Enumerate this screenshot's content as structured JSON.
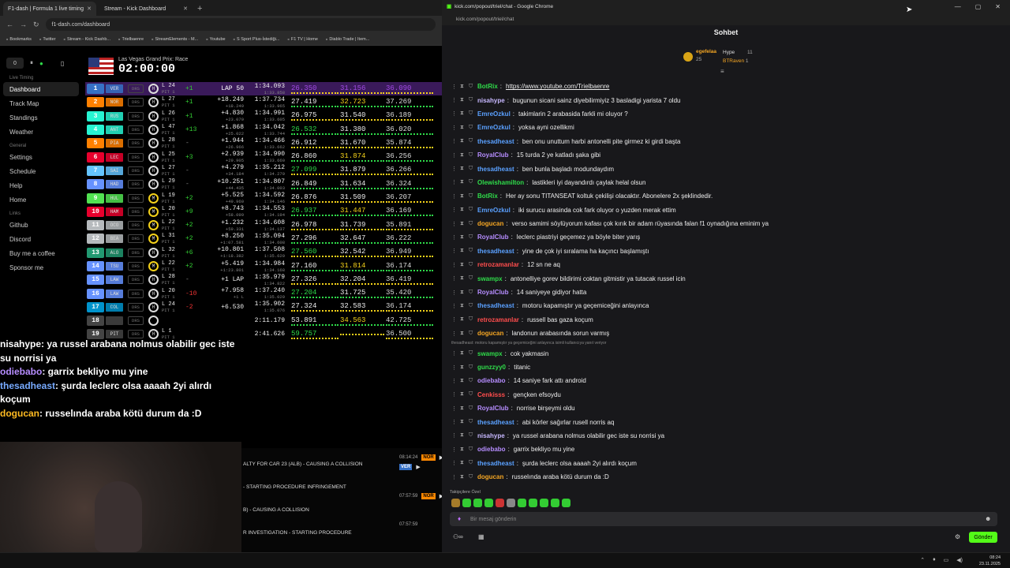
{
  "colors": {
    "purple": "#a24be4",
    "green": "#2fdc4a",
    "yellow": "#f5d21a",
    "kick": "#53fc18",
    "lead_row": "#3a1a5a"
  },
  "browser_left": {
    "tabs": [
      {
        "label": "F1-dash | Formula 1 live timing"
      },
      {
        "label": "Stream - Kick Dashboard"
      }
    ],
    "url": "f1-dash.com/dashboard",
    "bookmarks": [
      "Bookmarks",
      "Twitter",
      "Stream - Kick Dashb...",
      "Trielbaenre",
      "StreamElements - M...",
      "Youtube",
      "S Sport Plus-İstediği...",
      "F1 TV | Home",
      "Diablo Trade | Item..."
    ]
  },
  "dashboard": {
    "counter": "0",
    "nav_groups": [
      {
        "label": "Live Timing",
        "items": [
          "Dashboard",
          "Track Map",
          "Standings",
          "Weather"
        ]
      },
      {
        "label": "General",
        "items": [
          "Settings",
          "Schedule",
          "Help",
          "Home"
        ]
      },
      {
        "label": "Links",
        "items": [
          "Github",
          "Discord",
          "Buy me a coffee",
          "Sponsor me"
        ]
      }
    ],
    "race_name": "Las Vegas Grand Prix: Race",
    "race_clock": "02:00:00",
    "drivers": [
      {
        "pos": "1",
        "code": "VER",
        "color": "#3671c6",
        "tyre": "H",
        "lap": "L 24",
        "pit": "PIT 1",
        "gain": "+1",
        "gap": "LAP 50",
        "gap2": "",
        "last": "1:34.093",
        "best": "1:33.858",
        "s1": "26.350",
        "s2": "31.156",
        "s3": "36.090"
      },
      {
        "pos": "2",
        "code": "NOR",
        "color": "#ff8000",
        "tyre": "H",
        "lap": "L 27",
        "pit": "PIT 1",
        "gain": "+1",
        "gap": "+18.249",
        "gap2": "+18.249",
        "last": "1:37.734",
        "best": "1:33.965",
        "s1": "27.419",
        "s2": "32.723",
        "s3": "37.269"
      },
      {
        "pos": "3",
        "code": "RUS",
        "color": "#27f4d2",
        "tyre": "H",
        "lap": "L 26",
        "pit": "PIT 1",
        "gain": "+1",
        "gap": "+4.830",
        "gap2": "+23.079",
        "last": "1:34.991",
        "best": "1:33.605",
        "s1": "26.975",
        "s2": "31.540",
        "s3": "36.189"
      },
      {
        "pos": "4",
        "code": "ANT",
        "color": "#27f4d2",
        "tyre": "H",
        "lap": "L 47",
        "pit": "PIT 1",
        "gain": "+13",
        "gap": "+1.868",
        "gap2": "+25.022",
        "last": "1:34.042",
        "best": "1:33.744",
        "s1": "26.532",
        "s2": "31.380",
        "s3": "36.020"
      },
      {
        "pos": "5",
        "code": "PIA",
        "color": "#ff8000",
        "tyre": "H",
        "lap": "L 28",
        "pit": "PIT 1",
        "gain": "-",
        "gap": "+1.944",
        "gap2": "+26.966",
        "last": "1:34.466",
        "best": "1:33.662",
        "s1": "26.912",
        "s2": "31.670",
        "s3": "35.874"
      },
      {
        "pos": "6",
        "code": "LEC",
        "color": "#e8002d",
        "tyre": "H",
        "lap": "L 25",
        "pit": "PIT 1",
        "gain": "+3",
        "gap": "+2.939",
        "gap2": "+29.905",
        "last": "1:34.990",
        "best": "1:33.660",
        "s1": "26.860",
        "s2": "31.874",
        "s3": "36.256"
      },
      {
        "pos": "7",
        "code": "SAI",
        "color": "#64c4ff",
        "tyre": "H",
        "lap": "L 27",
        "pit": "PIT 1",
        "gain": "-",
        "gap": "+4.279",
        "gap2": "+34.184",
        "last": "1:35.212",
        "best": "1:34.279",
        "s1": "27.099",
        "s2": "31.879",
        "s3": "36.266"
      },
      {
        "pos": "8",
        "code": "HAD",
        "color": "#6692ff",
        "tyre": "H",
        "lap": "L 29",
        "pit": "PIT 1",
        "gain": "-",
        "gap": "+10.251",
        "gap2": "+44.435",
        "last": "1:34.807",
        "best": "1:34.003",
        "s1": "26.849",
        "s2": "31.634",
        "s3": "36.324"
      },
      {
        "pos": "9",
        "code": "HUL",
        "color": "#52e252",
        "tyre": "M",
        "lap": "L 19",
        "pit": "PIT 1",
        "gain": "+2",
        "gap": "+5.525",
        "gap2": "+49.960",
        "last": "1:34.592",
        "best": "1:34.146",
        "s1": "26.876",
        "s2": "31.509",
        "s3": "36.207"
      },
      {
        "pos": "10",
        "code": "HAM",
        "color": "#e8002d",
        "tyre": "M",
        "lap": "L 20",
        "pit": "PIT 1",
        "gain": "+9",
        "gap": "+8.743",
        "gap2": "+58.099",
        "last": "1:34.553",
        "best": "1:34.194",
        "s1": "26.937",
        "s2": "31.447",
        "s3": "36.169"
      },
      {
        "pos": "11",
        "code": "OCO",
        "color": "#b6babd",
        "tyre": "M",
        "lap": "L 22",
        "pit": "PIT 1",
        "gain": "+2",
        "gap": "+1.232",
        "gap2": "+59.331",
        "last": "1:34.608",
        "best": "1:34.137",
        "s1": "26.978",
        "s2": "31.739",
        "s3": "35.891"
      },
      {
        "pos": "12",
        "code": "BEA",
        "color": "#b6babd",
        "tyre": "M",
        "lap": "L 31",
        "pit": "PIT 1",
        "gain": "+2",
        "gap": "+8.250",
        "gap2": "+1:07.581",
        "last": "1:35.094",
        "best": "1:34.608",
        "s1": "27.296",
        "s2": "32.647",
        "s3": "36.222"
      },
      {
        "pos": "13",
        "code": "ALO",
        "color": "#229971",
        "tyre": "H",
        "lap": "L 32",
        "pit": "PIT 1",
        "gain": "+6",
        "gap": "+10.801",
        "gap2": "+1:18.382",
        "last": "1:37.508",
        "best": "1:35.629",
        "s1": "27.560",
        "s2": "32.542",
        "s3": "36.949"
      },
      {
        "pos": "14",
        "code": "TSU",
        "color": "#6692ff",
        "tyre": "M",
        "lap": "L 22",
        "pit": "PIT 1",
        "gain": "+2",
        "gap": "+5.419",
        "gap2": "+1:23.801",
        "last": "1:34.984",
        "best": "1:34.168",
        "s1": "27.160",
        "s2": "31.814",
        "s3": "36.174"
      },
      {
        "pos": "15",
        "code": "LAW",
        "color": "#6692ff",
        "tyre": "H",
        "lap": "L 28",
        "pit": "PIT 1",
        "gain": "-",
        "gap": "+1 LAP",
        "gap2": "",
        "last": "1:35.979",
        "best": "1:34.822",
        "s1": "27.326",
        "s2": "32.204",
        "s3": "36.419"
      },
      {
        "pos": "16",
        "code": "LAW",
        "color": "#6692ff",
        "tyre": "H",
        "lap": "L 20",
        "pit": "PIT 1",
        "gain": "-10",
        "gap": "+7.958",
        "gap2": "+1 L",
        "last": "1:37.240",
        "best": "1:35.029",
        "s1": "27.204",
        "s2": "31.725",
        "s3": "35.420"
      },
      {
        "pos": "17",
        "code": "COL",
        "color": "#0093cc",
        "tyre": "H",
        "lap": "L 24",
        "pit": "PIT 1",
        "gain": "-2",
        "gap": "+6.530",
        "gap2": "",
        "last": "1:35.902",
        "best": "1:35.076",
        "s1": "27.324",
        "s2": "32.583",
        "s3": "36.174"
      },
      {
        "pos": "18",
        "code": "",
        "color": "#444",
        "tyre": "",
        "lap": "",
        "pit": "",
        "gain": "",
        "gap": "",
        "gap2": "",
        "last": "2:11.179",
        "best": "",
        "s1": "53.891",
        "s2": "34.563",
        "s3": "42.725"
      },
      {
        "pos": "19",
        "code": "PIT",
        "color": "#444",
        "tyre": "H",
        "lap": "L 1",
        "pit": "PIT 1",
        "gain": "",
        "gap": "",
        "gap2": "",
        "last": "2:41.626",
        "best": "",
        "s1": "59.757",
        "s2": "",
        "s3": "36.500"
      }
    ],
    "race_control": [
      "ALTY FOR CAR 23 (ALB) - CAUSING A COLLISION",
      "- STARTING PROCEDURE INFRINGEMENT",
      "B) - CAUSING A COLLISION",
      "R INVESTIGATION - STARTING PROCEDURE"
    ],
    "radios": [
      {
        "time": "08:14:24",
        "driver": "NOR"
      },
      {
        "time": "",
        "driver": "VER"
      },
      {
        "time": "07:57:59",
        "driver": "NOR"
      },
      {
        "time": "07:57:59",
        "driver": ""
      }
    ]
  },
  "overlay_chat": [
    {
      "user": "nisahype",
      "text": ": ya russel arabana nolmus olabilir gec iste su norrisi ya",
      "color": "#ffffff"
    },
    {
      "user": "odiebabo",
      "text": ": garrix bekliyo mu yine",
      "color": "#b68dff"
    },
    {
      "user": "thesadheast",
      "text": ": şurda leclerc olsa aaaah 2yi alırdı koçum",
      "color": "#7af"
    },
    {
      "user": "dogucan",
      "text": ": russelında araba kötü durum da :D",
      "color": "#fb2"
    }
  ],
  "browser_right": {
    "title": "kick.com/popout/triel/chat - Google Chrome",
    "url": "kick.com/popout/triel/chat",
    "chat_title": "Sohbet",
    "leaders": [
      {
        "name": "egefelaa",
        "count": "25"
      },
      {
        "name": "Hype",
        "count": "11"
      },
      {
        "name": "BTRaven",
        "count": "1"
      }
    ],
    "messages": [
      {
        "user": "BotRix",
        "color": "#2fdc4a",
        "text": "https://www.youtube.com/Trielbaenre",
        "link": true
      },
      {
        "user": "nisahype",
        "color": "#c7b8ff",
        "text": "bugunun sicani sainz diyebilirmiyiz 3 basladigi yarista 7 oldu"
      },
      {
        "user": "EmreOzkul",
        "color": "#5aa0ff",
        "text": "takimlarin 2 arabasida farkli mi oluyor ?"
      },
      {
        "user": "EmreOzkul",
        "color": "#5aa0ff",
        "text": "yoksa ayni ozellikmi"
      },
      {
        "user": "thesadheast",
        "color": "#5aa0ff",
        "text": "ben onu unuttum harbi antonelli pite girmez ki girdi başta"
      },
      {
        "user": "RoyalClub",
        "color": "#b68dff",
        "text": "15 turda 2 ye katladı şaka gibi"
      },
      {
        "user": "thesadheast",
        "color": "#5aa0ff",
        "text": "ben bunla başladı modundaydım"
      },
      {
        "user": "Olewishamilton",
        "color": "#2fdc4a",
        "text": "lastikleri iyi dayandırdı çaylak helal olsun"
      },
      {
        "user": "BotRix",
        "color": "#2fdc4a",
        "text": "Her ay sonu TITANSEAT koltuk çekilişi olacaktır. Abonelere 2x şeklindedir."
      },
      {
        "user": "EmreOzkul",
        "color": "#5aa0ff",
        "text": "iki surucu arasinda cok fark oluyor o yuzden merak ettim"
      },
      {
        "user": "dogucan",
        "color": "#f5a623",
        "text": "verso samimi söylüyorum kafası çok kırık bir adam rüyasında falan f1 oynadığına eminim ya"
      },
      {
        "user": "RoyalClub",
        "color": "#b68dff",
        "text": "leclerc piastriyi geçemez ya böyle biter yarış"
      },
      {
        "user": "thesadheast",
        "color": "#5aa0ff",
        "text": "yine de çok iyi sıralama ha kaçıncı başlamıştı"
      },
      {
        "user": "retrozamanlar",
        "color": "#ff4d4d",
        "text": "12 sn ne aq"
      },
      {
        "user": "swampx",
        "color": "#2fdc4a",
        "text": "antonelliye gorev bildirimi coktan gitmistir ya tutacak russel icin"
      },
      {
        "user": "RoyalClub",
        "color": "#b68dff",
        "text": "14 saniyeye gidiyor hatta"
      },
      {
        "user": "thesadheast",
        "color": "#5aa0ff",
        "text": "motoru kapamıştır ya geçemiceğini anlayınca"
      },
      {
        "user": "retrozamanlar",
        "color": "#ff4d4d",
        "text": "russell bas gaza koçum"
      },
      {
        "user": "dogucan",
        "color": "#f5a623",
        "text": "landonun arabasında sorun varmış"
      },
      {
        "user": "",
        "color": "#888",
        "text": "thesadheast: motoru kapamıştır ya geçemiceğini anlayınca isimli kullanıcıya yanıt veriyor",
        "note": true
      },
      {
        "user": "swampx",
        "color": "#2fdc4a",
        "text": "cok yakmasin"
      },
      {
        "user": "gunzzyy0",
        "color": "#2fdc4a",
        "text": "titanic"
      },
      {
        "user": "odiebabo",
        "color": "#b68dff",
        "text": "14 saniye fark attı android"
      },
      {
        "user": "Cenkisss",
        "color": "#ff4d4d",
        "text": "gençken efsoydu"
      },
      {
        "user": "RoyalClub",
        "color": "#b68dff",
        "text": "norrise birşeymi oldu"
      },
      {
        "user": "thesadheast",
        "color": "#5aa0ff",
        "text": "abi körler sağırlar rusell norris aq"
      },
      {
        "user": "nisahype",
        "color": "#c7b8ff",
        "text": "ya russel arabana nolmus olabilir gec iste su norrisi ya"
      },
      {
        "user": "odiebabo",
        "color": "#b68dff",
        "text": "garrix bekliyo mu yine"
      },
      {
        "user": "thesadheast",
        "color": "#5aa0ff",
        "text": "şurda leclerc olsa aaaah 2yi alırdı koçum"
      },
      {
        "user": "dogucan",
        "color": "#f5a623",
        "text": "russelında araba kötü durum da :D"
      }
    ],
    "pinned_label": "Takipçilere Özel",
    "input_placeholder": "Bir mesaj gönderin",
    "send_label": "Gönder"
  },
  "taskbar": {
    "time": "08:24",
    "date": "23.11.2025"
  }
}
